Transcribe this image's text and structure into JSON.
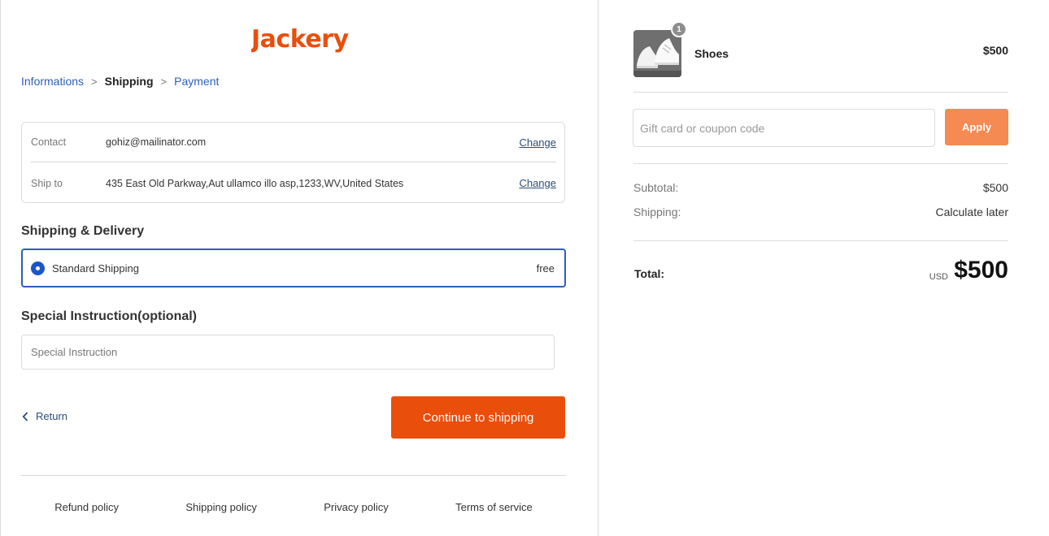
{
  "brand": {
    "logo_text": "Jackery",
    "accent_color": "#ea4e0b",
    "link_color": "#2b5fb8"
  },
  "breadcrumb": {
    "items": [
      {
        "label": "Informations",
        "state": "link"
      },
      {
        "label": "Shipping",
        "state": "current"
      },
      {
        "label": "Payment",
        "state": "link"
      }
    ],
    "separator": ">"
  },
  "info": {
    "contact": {
      "label": "Contact",
      "value": "gohiz@mailinator.com",
      "action": "Change"
    },
    "ship_to": {
      "label": "Ship to",
      "value": "435 East Old Parkway,Aut ullamco illo asp,1233,WV,United States",
      "action": "Change"
    }
  },
  "shipping_section": {
    "title": "Shipping & Delivery",
    "option": {
      "label": "Standard Shipping",
      "price": "free",
      "selected": true
    }
  },
  "special_section": {
    "title": "Special Instruction(optional)",
    "placeholder": "Special Instruction"
  },
  "actions": {
    "return_label": "Return",
    "continue_label": "Continue to shipping"
  },
  "footer": {
    "links": [
      "Refund policy",
      "Shipping policy",
      "Privacy policy",
      "Terms of service"
    ]
  },
  "cart": {
    "item": {
      "name": "Shoes",
      "price": "$500",
      "quantity": "1"
    },
    "coupon": {
      "placeholder": "Gift card or coupon code",
      "button_label": "Apply",
      "button_color": "#f58a52"
    },
    "summary": {
      "subtotal_label": "Subtotal:",
      "subtotal_value": "$500",
      "shipping_label": "Shipping:",
      "shipping_value": "Calculate later",
      "total_label": "Total:",
      "currency": "USD",
      "total_value": "$500"
    }
  }
}
